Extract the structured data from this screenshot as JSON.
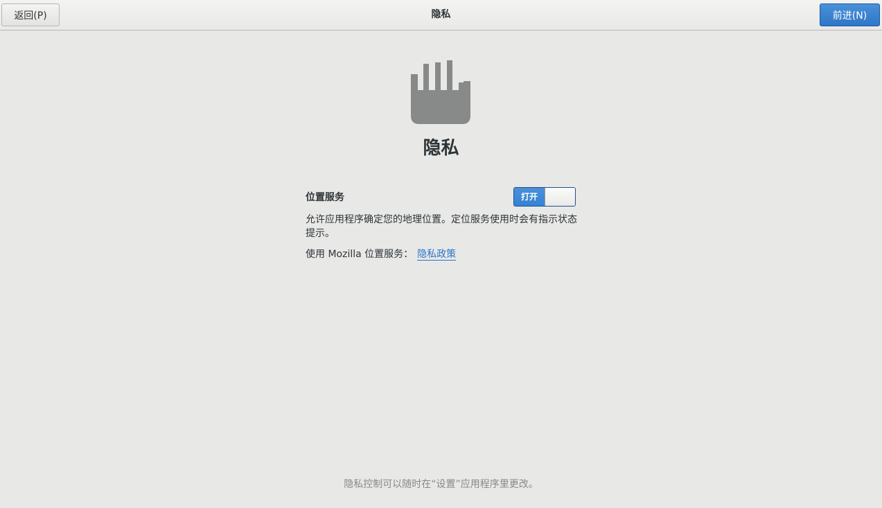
{
  "header": {
    "title": "隐私",
    "back_label": "返回(P)",
    "next_label": "前进(N)"
  },
  "main": {
    "icon": "hand-stop-icon",
    "heading": "隐私",
    "location": {
      "label": "位置服务",
      "switch_state_label": "打开",
      "enabled": true,
      "description": "允许应用程序确定您的地理位置。定位服务使用时会有指示状态提示。",
      "mozilla_text": "使用  Mozilla 位置服务：",
      "policy_link_label": "隐私政策"
    },
    "footer_note": "隐私控制可以随时在“设置”应用程序里更改。"
  },
  "colors": {
    "accent": "#4a90d9",
    "icon_gray": "#888a8a",
    "background": "#e8e8e7"
  }
}
